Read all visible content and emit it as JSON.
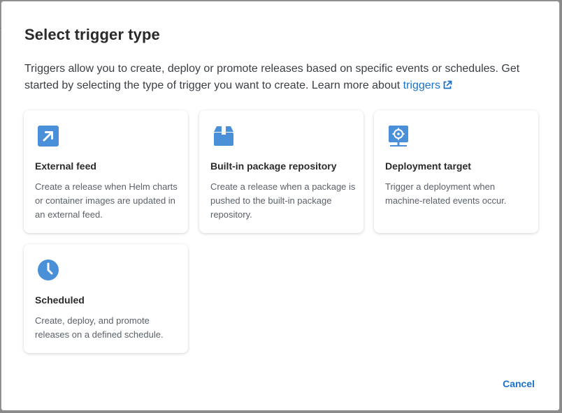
{
  "dialog": {
    "title": "Select trigger type",
    "description": "Triggers allow you to create, deploy or promote releases based on specific events or schedules. Get started by selecting the type of trigger you want to create. Learn more about",
    "link_text": "triggers",
    "accent_color": "#1a73c8",
    "icon_color": "#4a90d9"
  },
  "cards": [
    {
      "icon": "external-arrow-icon",
      "title": "External feed",
      "description": "Create a release when Helm charts or container images are updated in an external feed."
    },
    {
      "icon": "package-box-icon",
      "title": "Built-in package repository",
      "description": "Create a release when a package is pushed to the built-in package repository."
    },
    {
      "icon": "monitor-target-icon",
      "title": "Deployment target",
      "description": "Trigger a deployment when machine-related events occur."
    },
    {
      "icon": "clock-icon",
      "title": "Scheduled",
      "description": "Create, deploy, and promote releases on a defined schedule."
    }
  ],
  "footer": {
    "cancel_label": "Cancel"
  }
}
